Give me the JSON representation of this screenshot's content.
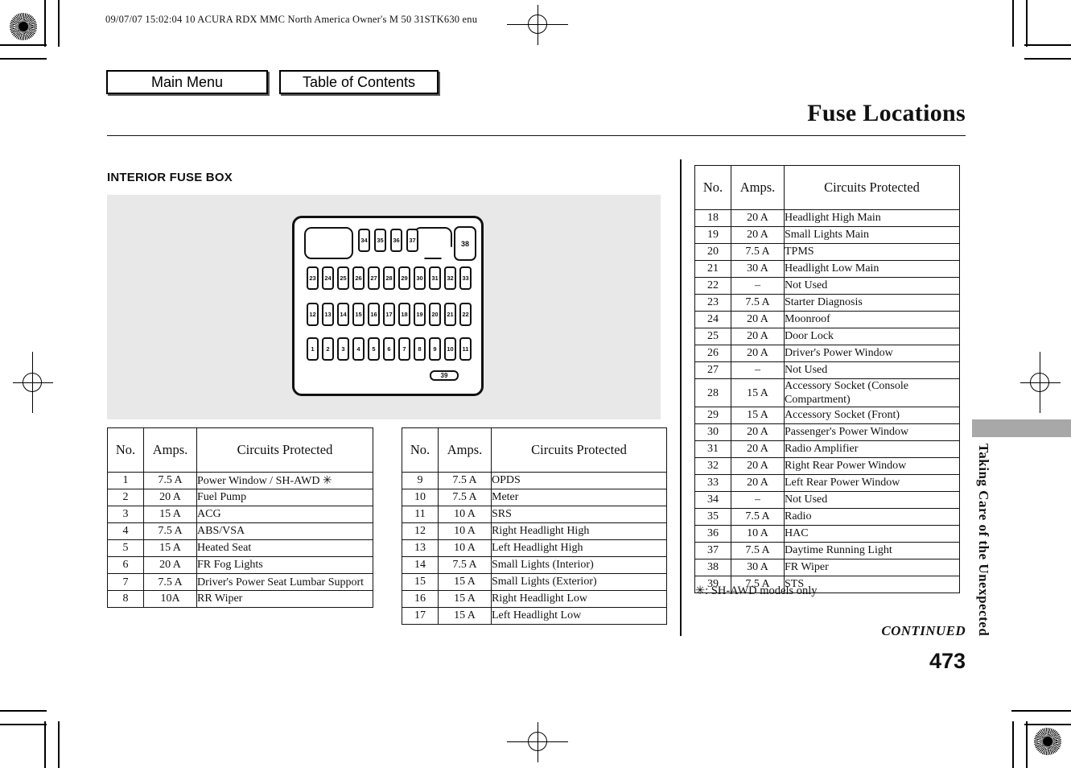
{
  "document": {
    "header_line": "09/07/07 15:02:04    10 ACURA RDX MMC North America Owner's M 50 31STK630 enu",
    "page_title": "Fuse Locations",
    "section_heading": "INTERIOR FUSE BOX",
    "footnote": "✳: SH-AWD models only",
    "continued": "CONTINUED",
    "page_number": "473",
    "side_tab": "Taking Care of the Unexpected"
  },
  "nav": {
    "main_menu": "Main Menu",
    "table_of_contents": "Table of Contents"
  },
  "diagram": {
    "name": "interior-fuse-box-diagram",
    "relay_big_label": "",
    "relay_mid_label": "",
    "relay_38_label": "38",
    "fuse_39_label": "39",
    "row_top": [
      "34",
      "35",
      "36",
      "37"
    ],
    "row_23_33": [
      "23",
      "24",
      "25",
      "26",
      "27",
      "28",
      "29",
      "30",
      "31",
      "32",
      "33"
    ],
    "row_12_22": [
      "12",
      "13",
      "14",
      "15",
      "16",
      "17",
      "18",
      "19",
      "20",
      "21",
      "22"
    ],
    "row_1_11": [
      "1",
      "2",
      "3",
      "4",
      "5",
      "6",
      "7",
      "8",
      "9",
      "10",
      "11"
    ]
  },
  "tables": {
    "headers": {
      "no": "No.",
      "amps": "Amps.",
      "circuits": "Circuits Protected"
    },
    "left": [
      {
        "no": "1",
        "amps": "7.5 A",
        "desc": "Power Window / SH-AWD ✳",
        "lines": 1
      },
      {
        "no": "2",
        "amps": "20 A",
        "desc": "Fuel Pump",
        "lines": 1
      },
      {
        "no": "3",
        "amps": "15 A",
        "desc": "ACG",
        "lines": 1
      },
      {
        "no": "4",
        "amps": "7.5 A",
        "desc": "ABS/VSA",
        "lines": 1
      },
      {
        "no": "5",
        "amps": "15 A",
        "desc": "Heated Seat",
        "lines": 1
      },
      {
        "no": "6",
        "amps": "20 A",
        "desc": "FR Fog Lights",
        "lines": 1
      },
      {
        "no": "7",
        "amps": "7.5 A",
        "desc": "Driver's Power Seat Lumbar Support",
        "lines": 2
      },
      {
        "no": "8",
        "amps": "10A",
        "desc": "RR Wiper",
        "lines": 1
      }
    ],
    "middle": [
      {
        "no": "9",
        "amps": "7.5 A",
        "desc": "OPDS",
        "lines": 1
      },
      {
        "no": "10",
        "amps": "7.5 A",
        "desc": "Meter",
        "lines": 1
      },
      {
        "no": "11",
        "amps": "10 A",
        "desc": "SRS",
        "lines": 1
      },
      {
        "no": "12",
        "amps": "10 A",
        "desc": "Right Headlight High",
        "lines": 1
      },
      {
        "no": "13",
        "amps": "10 A",
        "desc": "Left Headlight High",
        "lines": 1
      },
      {
        "no": "14",
        "amps": "7.5 A",
        "desc": "Small Lights (Interior)",
        "lines": 1
      },
      {
        "no": "15",
        "amps": "15 A",
        "desc": "Small Lights (Exterior)",
        "lines": 1
      },
      {
        "no": "16",
        "amps": "15 A",
        "desc": "Right Headlight Low",
        "lines": 1
      },
      {
        "no": "17",
        "amps": "15 A",
        "desc": "Left Headlight Low",
        "lines": 1
      }
    ],
    "right": [
      {
        "no": "18",
        "amps": "20 A",
        "desc": "Headlight High Main",
        "lines": 1
      },
      {
        "no": "19",
        "amps": "20 A",
        "desc": "Small Lights Main",
        "lines": 1
      },
      {
        "no": "20",
        "amps": "7.5 A",
        "desc": "TPMS",
        "lines": 1
      },
      {
        "no": "21",
        "amps": "30 A",
        "desc": "Headlight Low Main",
        "lines": 1
      },
      {
        "no": "22",
        "amps": "–",
        "desc": "Not Used",
        "lines": 1
      },
      {
        "no": "23",
        "amps": "7.5 A",
        "desc": "Starter Diagnosis",
        "lines": 1
      },
      {
        "no": "24",
        "amps": "20 A",
        "desc": "Moonroof",
        "lines": 1
      },
      {
        "no": "25",
        "amps": "20 A",
        "desc": "Door Lock",
        "lines": 1
      },
      {
        "no": "26",
        "amps": "20 A",
        "desc": "Driver's Power Window",
        "lines": 1
      },
      {
        "no": "27",
        "amps": "–",
        "desc": "Not Used",
        "lines": 1
      },
      {
        "no": "28",
        "amps": "15 A",
        "desc": "Accessory Socket (Console Compartment)",
        "lines": 2
      },
      {
        "no": "29",
        "amps": "15 A",
        "desc": "Accessory Socket (Front)",
        "lines": 1
      },
      {
        "no": "30",
        "amps": "20 A",
        "desc": "Passenger's Power Window",
        "lines": 1
      },
      {
        "no": "31",
        "amps": "20 A",
        "desc": "Radio Amplifier",
        "lines": 1
      },
      {
        "no": "32",
        "amps": "20 A",
        "desc": "Right Rear Power Window",
        "lines": 1
      },
      {
        "no": "33",
        "amps": "20 A",
        "desc": "Left Rear Power Window",
        "lines": 1
      },
      {
        "no": "34",
        "amps": "–",
        "desc": "Not Used",
        "lines": 1
      },
      {
        "no": "35",
        "amps": "7.5 A",
        "desc": "Radio",
        "lines": 1
      },
      {
        "no": "36",
        "amps": "10 A",
        "desc": "HAC",
        "lines": 1
      },
      {
        "no": "37",
        "amps": "7.5 A",
        "desc": "Daytime Running Light",
        "lines": 1
      },
      {
        "no": "38",
        "amps": "30 A",
        "desc": "FR Wiper",
        "lines": 1
      },
      {
        "no": "39",
        "amps": "7.5 A",
        "desc": "STS",
        "lines": 1
      }
    ]
  },
  "colors": {
    "panel_gray": "#e8e8e8",
    "tab_gray": "#a8a8a8",
    "ink": "#111111"
  }
}
